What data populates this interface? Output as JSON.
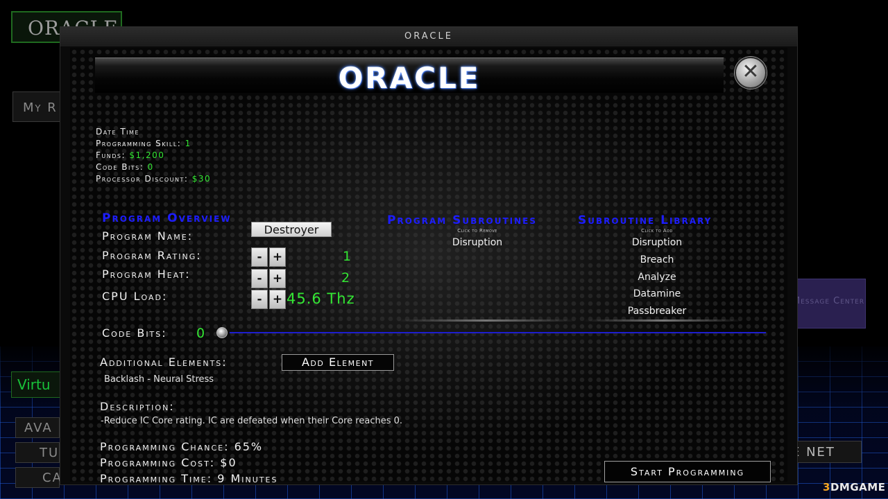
{
  "background": {
    "logo": "ORACLE",
    "my_button": "My R",
    "message_center": "Message Center",
    "virtual_label": "Virtu",
    "buttons": [
      "AVA",
      "TU",
      "CA"
    ],
    "net_button": "E NET",
    "watermark_num": "3",
    "watermark_text": "DMGAME"
  },
  "window": {
    "title": "ORACLE"
  },
  "header": {
    "title": "ORACLE",
    "close_glyph": "✕"
  },
  "stats": {
    "date_time_label": "Date Time",
    "programming_skill_label": "Programming Skill:",
    "programming_skill_value": "1",
    "funds_label": "Funds:",
    "funds_value": "$1,200",
    "code_bits_label": "Code Bits:",
    "code_bits_value": "0",
    "processor_discount_label": "Processor Discount:",
    "processor_discount_value": "$30"
  },
  "overview": {
    "title": "Program Overview",
    "name_label": "Program Name:",
    "name_value": "Destroyer",
    "rating_label": "Program Rating:",
    "rating_value": "1",
    "heat_label": "Program Heat:",
    "heat_value": "2",
    "cpu_label": "CPU Load:",
    "cpu_value": "45.6 Thz",
    "code_bits_label": "Code Bits:",
    "code_bits_value": "0",
    "code_bits_slider_fraction": 0,
    "minus": "-",
    "plus": "+"
  },
  "subroutines": {
    "title": "Program Subroutines",
    "hint": "Click to Remove",
    "items": [
      "Disruption"
    ]
  },
  "library": {
    "title": "Subroutine Library",
    "hint": "Click to Add",
    "items": [
      "Disruption",
      "Breach",
      "Analyze",
      "Datamine",
      "Passbreaker"
    ]
  },
  "elements": {
    "label": "Additional Elements:",
    "button": "Add Element",
    "item": "Backlash - Neural Stress"
  },
  "description": {
    "label": "Description:",
    "text": "-Reduce IC Core rating.  IC are defeated when their Core reaches 0."
  },
  "summary": {
    "chance": "Programming Chance: 65%",
    "cost": "Programming Cost: $0",
    "time": "Programming Time: 9 Minutes"
  },
  "actions": {
    "start": "Start Programming"
  },
  "colors": {
    "accent_blue": "#1d1dff",
    "value_green": "#33e633"
  }
}
